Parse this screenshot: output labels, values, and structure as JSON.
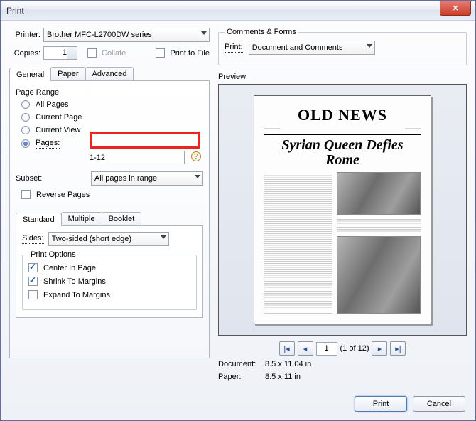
{
  "window": {
    "title": "Print"
  },
  "printer": {
    "label": "Printer:",
    "value": "Brother MFC-L2700DW series",
    "copies_label": "Copies:",
    "copies_value": "1",
    "collate_label": "Collate",
    "print_to_file_label": "Print to File"
  },
  "tabs_left": {
    "general": "General",
    "paper": "Paper",
    "advanced": "Advanced"
  },
  "page_range": {
    "legend": "Page Range",
    "all": "All Pages",
    "current_page": "Current Page",
    "current_view": "Current View",
    "pages_label": "Pages:",
    "pages_value": "1-12",
    "subset_label": "Subset:",
    "subset_value": "All pages in range",
    "reverse": "Reverse Pages"
  },
  "tabs_handling": {
    "standard": "Standard",
    "multiple": "Multiple",
    "booklet": "Booklet"
  },
  "sides": {
    "label": "Sides:",
    "value": "Two-sided (short edge)"
  },
  "print_options": {
    "legend": "Print Options",
    "center": "Center In Page",
    "shrink": "Shrink To Margins",
    "expand": "Expand To Margins"
  },
  "comments": {
    "legend": "Comments & Forms",
    "print_label": "Print:",
    "value": "Document and Comments"
  },
  "preview": {
    "label": "Preview",
    "masthead": "OLD NEWS",
    "headline": "Syrian Queen Defies Rome",
    "current_page": "1",
    "page_count_text": "(1 of 12)",
    "doc_label": "Document:",
    "doc_value": "8.5 x 11.04 in",
    "paper_label": "Paper:",
    "paper_value": "8.5 x 11 in"
  },
  "buttons": {
    "print": "Print",
    "cancel": "Cancel"
  }
}
